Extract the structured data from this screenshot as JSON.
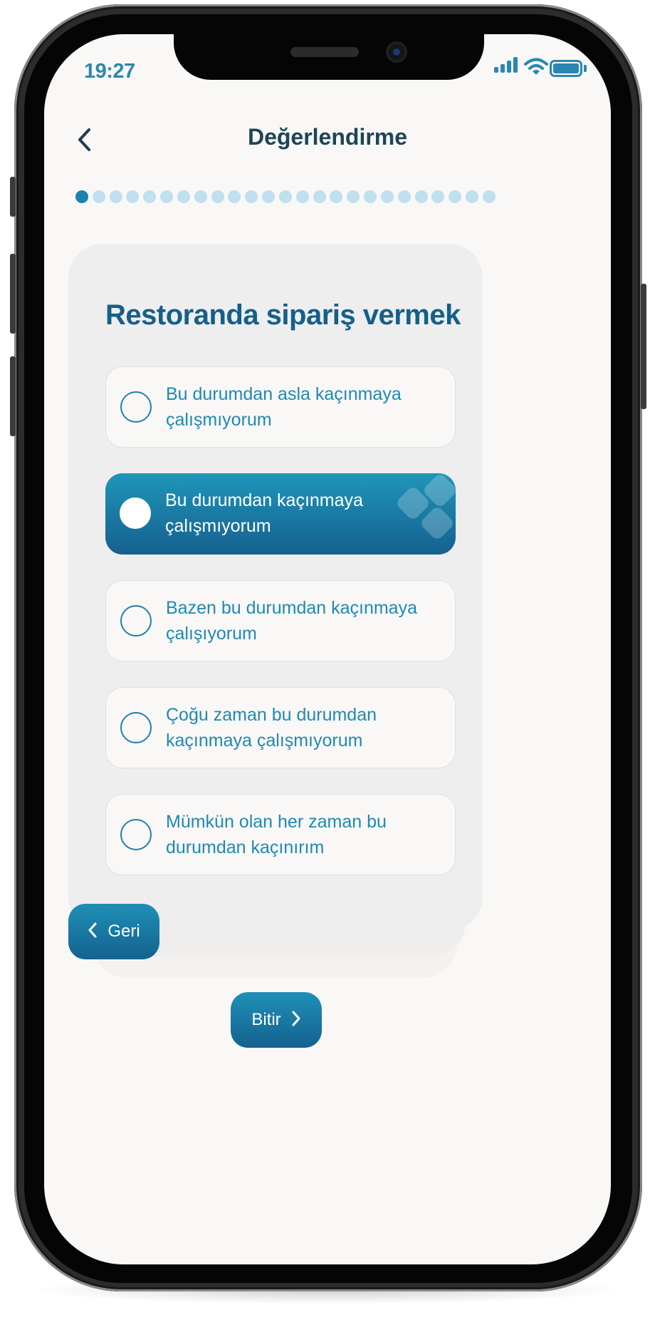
{
  "status_bar": {
    "time": "19:27",
    "icons": [
      "cellular-signal-icon",
      "wifi-icon",
      "battery-icon"
    ]
  },
  "header": {
    "title": "Değerlendirme",
    "back_icon": "chevron-left-icon"
  },
  "progress": {
    "total_steps": 25,
    "current_step": 1
  },
  "question": {
    "title": "Restoranda sipariş vermek",
    "options": [
      {
        "label": "Bu durumdan asla kaçınmaya çalışmıyorum",
        "selected": false
      },
      {
        "label": "Bu durumdan kaçınmaya çalışmıyorum",
        "selected": true
      },
      {
        "label": "Bazen bu durumdan kaçınmaya çalışıyorum",
        "selected": false
      },
      {
        "label": "Çoğu zaman bu durumdan kaçınmaya çalışmıyorum",
        "selected": false
      },
      {
        "label": "Mümkün olan her zaman bu durumdan kaçınırım",
        "selected": false
      }
    ]
  },
  "buttons": {
    "back_label": "Geri",
    "finish_label": "Bitir"
  },
  "colors": {
    "accent": "#1d81ad",
    "accent_light": "#bfe0ec",
    "title_dark": "#1e4557",
    "background": "#f9f8f6"
  }
}
